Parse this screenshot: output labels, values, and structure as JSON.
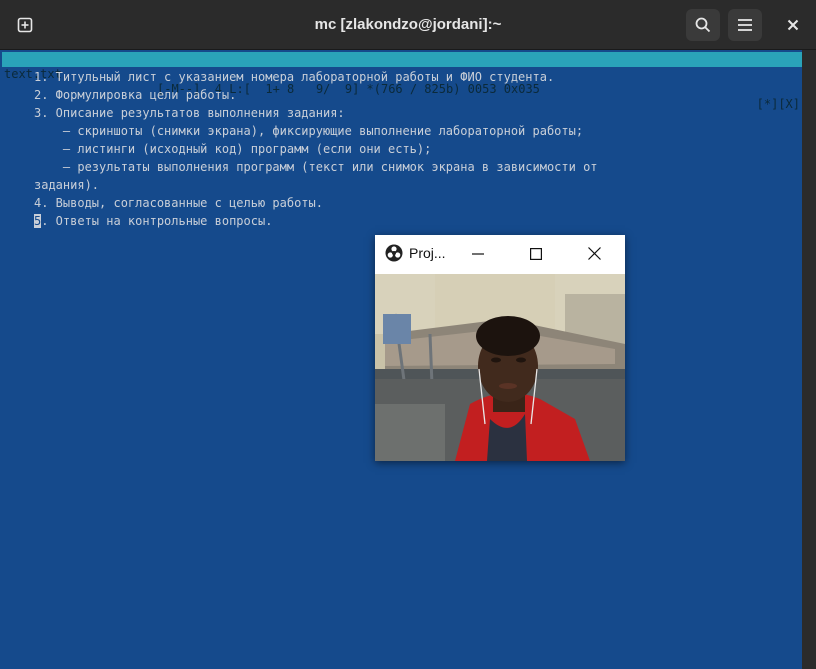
{
  "window": {
    "title": "mc [zlakondzo@jordani]:~",
    "buttons": [
      "new-tab",
      "search",
      "menu",
      "close"
    ]
  },
  "editor": {
    "status": {
      "filename": "text.txt",
      "info": "[-M--]  4 L:[  1+ 8   9/  9] *(766 / 825b) 0053 0x035",
      "flags": "[*][X]"
    },
    "lines": [
      "1. Титульный лист с указанием номера лабораторной работы и ФИО студента.",
      "2. Формулировка цели работы.",
      "3. Описание результатов выполнения задания:",
      "    – скриншоты (снимки экрана), фиксирующие выполнение лабораторной работы;",
      "    – листинги (исходный код) программ (если они есть);",
      "    – результаты выполнения программ (текст или снимок экрана в зависимости от",
      "задания).",
      "4. Выводы, согласованные с целью работы."
    ],
    "last_line": {
      "cursor_char": "5",
      "rest": ". Ответы на контрольные вопросы."
    }
  },
  "projector": {
    "title": "Proj...",
    "icon": "obs-icon",
    "content": "webcam video feed"
  },
  "colors": {
    "terminal_bg": "#154a8c",
    "status_bg": "#2aa3b9",
    "header_bg": "#2b2b2b"
  }
}
